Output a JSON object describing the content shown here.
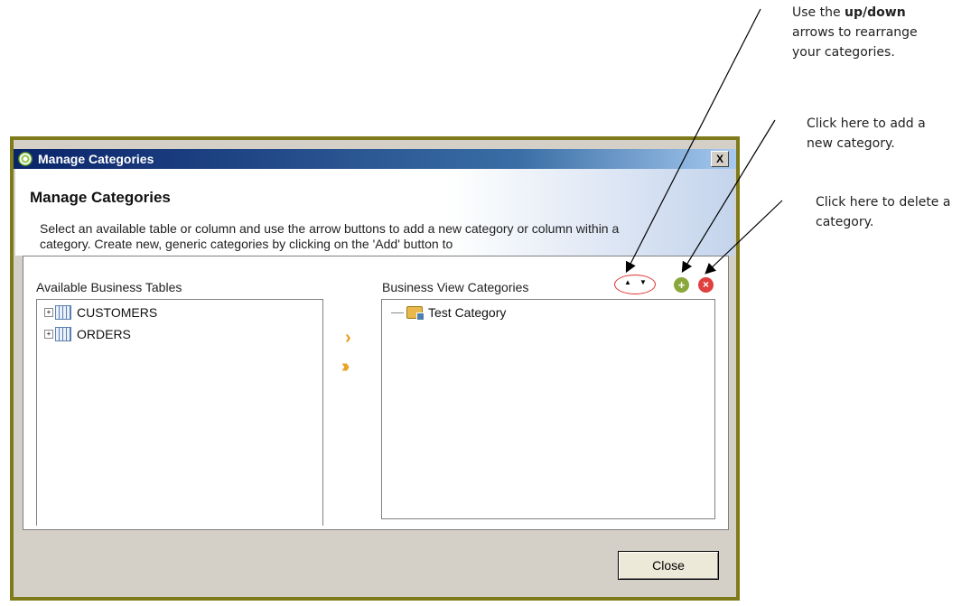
{
  "annotations": {
    "arrows_line1_prefix": "Use the ",
    "arrows_line1_bold": "up/down",
    "arrows_line2": "arrows to rearrange",
    "arrows_line3": "your categories.",
    "add_line1": "Click here to add a",
    "add_line2": "new category.",
    "delete_line1": "Click here to delete a",
    "delete_line2": "category."
  },
  "dialog": {
    "title": "Manage Categories",
    "close_glyph": "X",
    "header_title": "Manage Categories",
    "description": "Select an available table or column and use the arrow buttons to add a new category or column within a category. Create new, generic categories by clicking on the 'Add' button to",
    "available_label": "Available Business Tables",
    "bv_label": "Business View Categories",
    "available_tables": [
      "CUSTOMERS",
      "ORDERS"
    ],
    "categories": [
      "Test Category"
    ],
    "add_one_glyph": "›",
    "add_all_glyph": "››",
    "move_up_glyph": "▲",
    "move_down_glyph": "▼",
    "add_glyph": "+",
    "delete_glyph": "×",
    "close_button": "Close"
  },
  "colors": {
    "frame_border": "#7f7a1a",
    "annotation_circle": "#e0302a",
    "arrow_buttons": "#e89f1a"
  }
}
